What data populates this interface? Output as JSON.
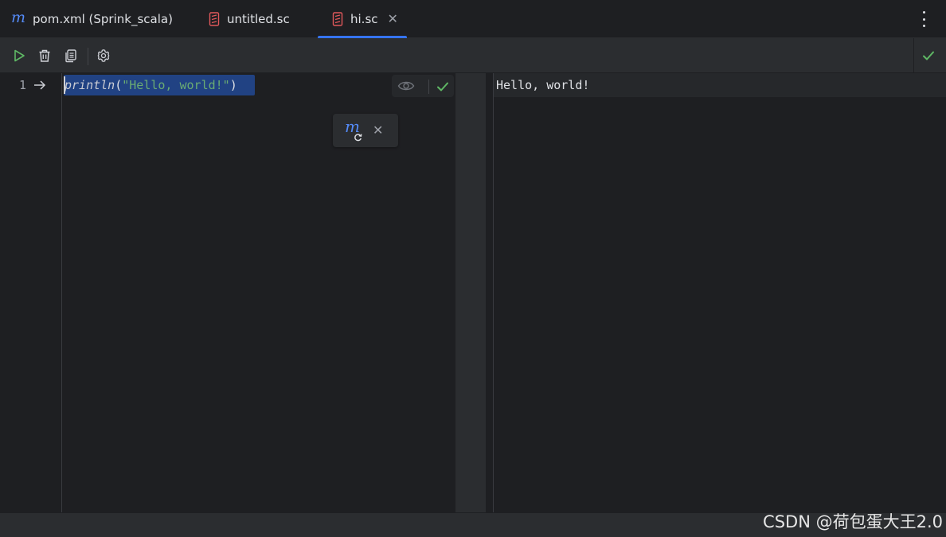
{
  "tabs": [
    {
      "label": "pom.xml (Sprink_scala)",
      "icon": "maven-icon",
      "active": false
    },
    {
      "label": "untitled.sc",
      "icon": "scala-file-icon",
      "active": false
    },
    {
      "label": "hi.sc",
      "icon": "scala-file-icon",
      "active": true,
      "close_glyph": "✕"
    }
  ],
  "toolbar": {
    "buttons": [
      "run-icon",
      "trash-icon",
      "copy-icon",
      "settings-icon"
    ],
    "status": "check-icon"
  },
  "editor": {
    "line_number": "1",
    "code": {
      "fn": "println",
      "open": "(",
      "string": "\"Hello, world!\"",
      "close": ")"
    },
    "popup": {
      "icon_text": "m",
      "close_glyph": "✕"
    }
  },
  "output": {
    "text": "Hello, world!"
  },
  "watermark": "CSDN @荷包蛋大王2.0",
  "colors": {
    "accent": "#3574f0",
    "background": "#1e1f22",
    "panel": "#2b2d30",
    "selection": "#214283",
    "string": "#6aab73",
    "success": "#5fb865",
    "scala_red": "#e0585b"
  }
}
